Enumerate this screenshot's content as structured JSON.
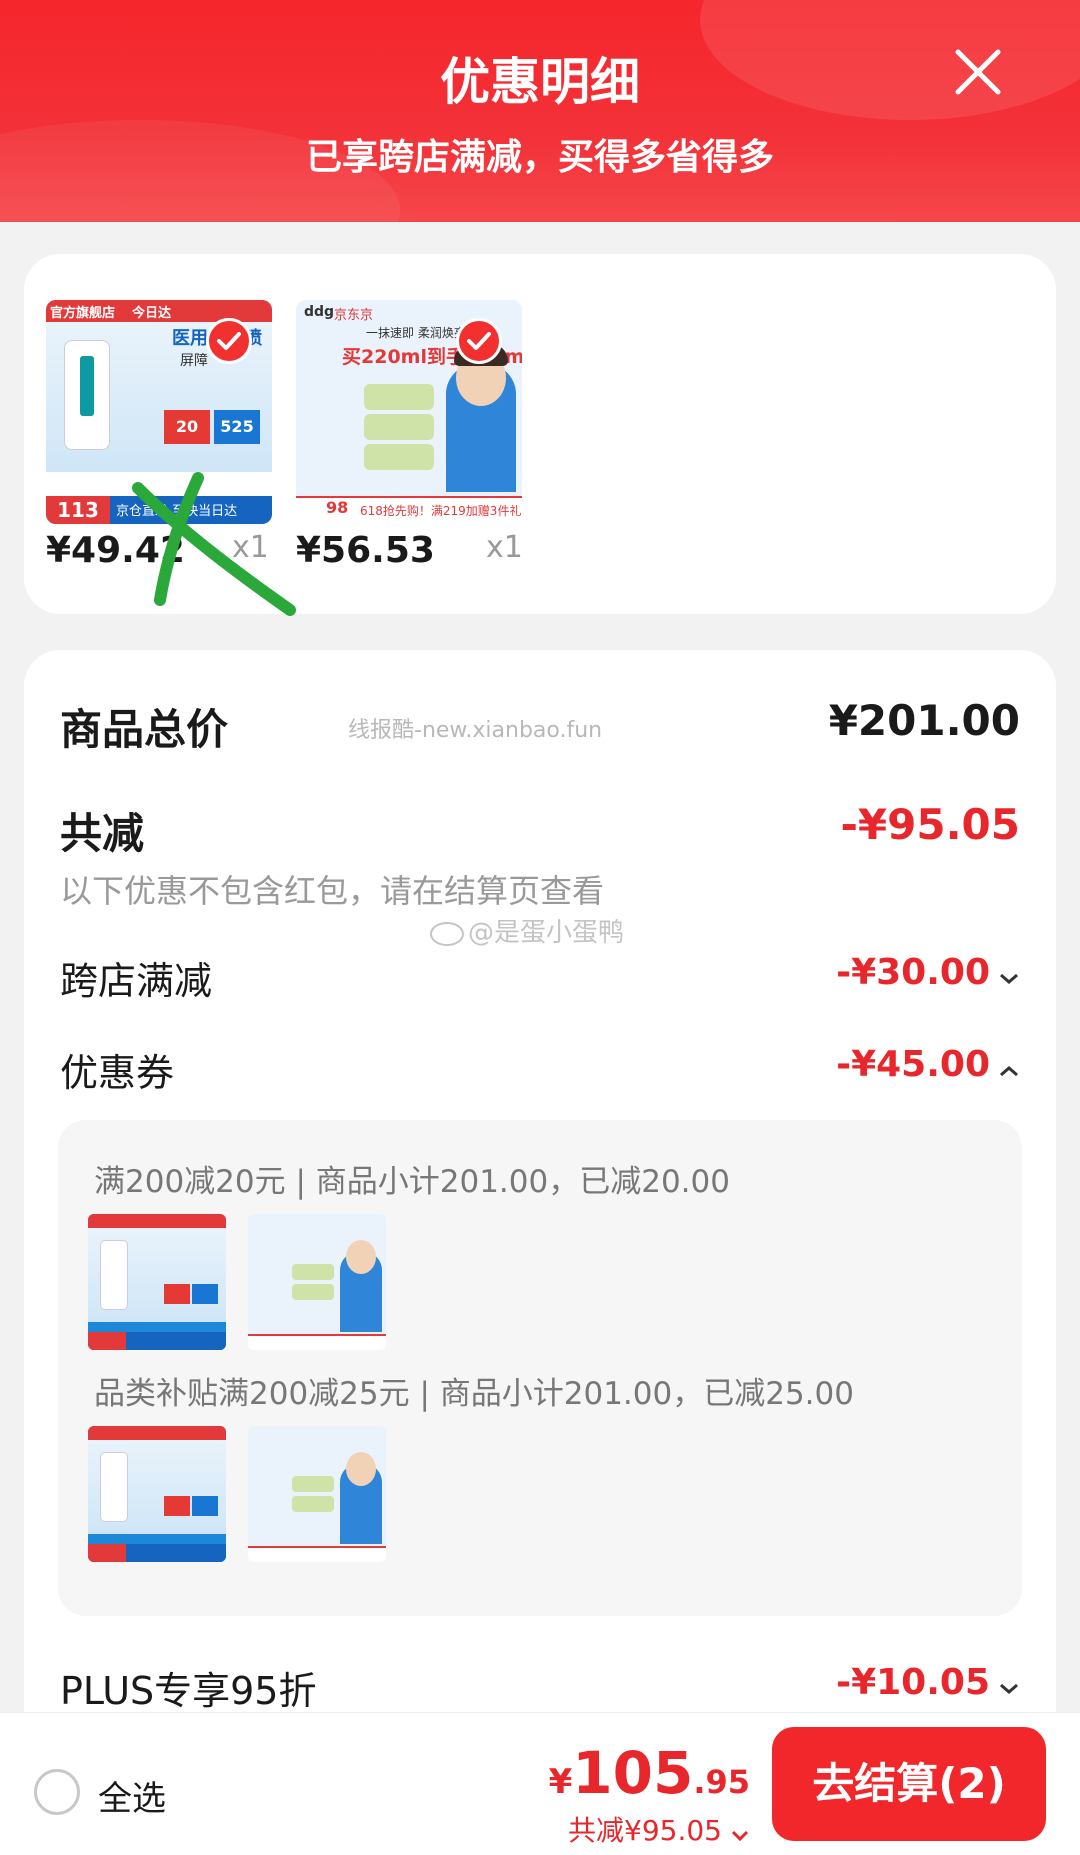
{
  "header": {
    "title": "优惠明细",
    "subtitle": "已享跨店满减，买得多省得多",
    "close_icon": "close-icon"
  },
  "products": [
    {
      "price": "¥49.42",
      "qty": "x1",
      "selected": true,
      "image_text": [
        "官方旗舰店",
        "今日达",
        "医用胶原喷",
        "屏障",
        "20",
        "525",
        "113",
        "京仓直发 至快当日达"
      ]
    },
    {
      "price": "¥56.53",
      "qty": "x1",
      "selected": true,
      "image_text": [
        "ddg",
        "京东京",
        "一抹速即 柔润焕亮",
        "买220ml到手235ml",
        "98",
        "618抢先购！满219加赠3件礼"
      ]
    }
  ],
  "summary": {
    "total_label": "商品总价",
    "total_value": "¥201.00",
    "watermark": "线报酷-new.xianbao.fun",
    "discount_label": "共减",
    "discount_value": "-¥95.05",
    "note": "以下优惠不包含红包，请在结算页查看",
    "weibo_watermark": "@是蛋小蛋鸭"
  },
  "discounts": [
    {
      "label": "跨店满减",
      "value": "-¥30.00",
      "expanded": false
    },
    {
      "label": "优惠券",
      "value": "-¥45.00",
      "expanded": true
    },
    {
      "label": "PLUS专享95折",
      "value": "-¥10.05",
      "expanded": false
    }
  ],
  "coupons": [
    {
      "text": "满200减20元 | 商品小计201.00，已减20.00"
    },
    {
      "text": "品类补贴满200减25元 | 商品小计201.00，已减25.00"
    }
  ],
  "bottom": {
    "select_all": "全选",
    "price_symbol": "¥",
    "price_int": "105",
    "price_dec": ".95",
    "saved": "共减¥95.05",
    "checkout": "去结算(2)"
  },
  "colors": {
    "accent": "#e8272c",
    "header": "#f5262c",
    "check": "#f23030",
    "annotation": "#2aa83a"
  }
}
